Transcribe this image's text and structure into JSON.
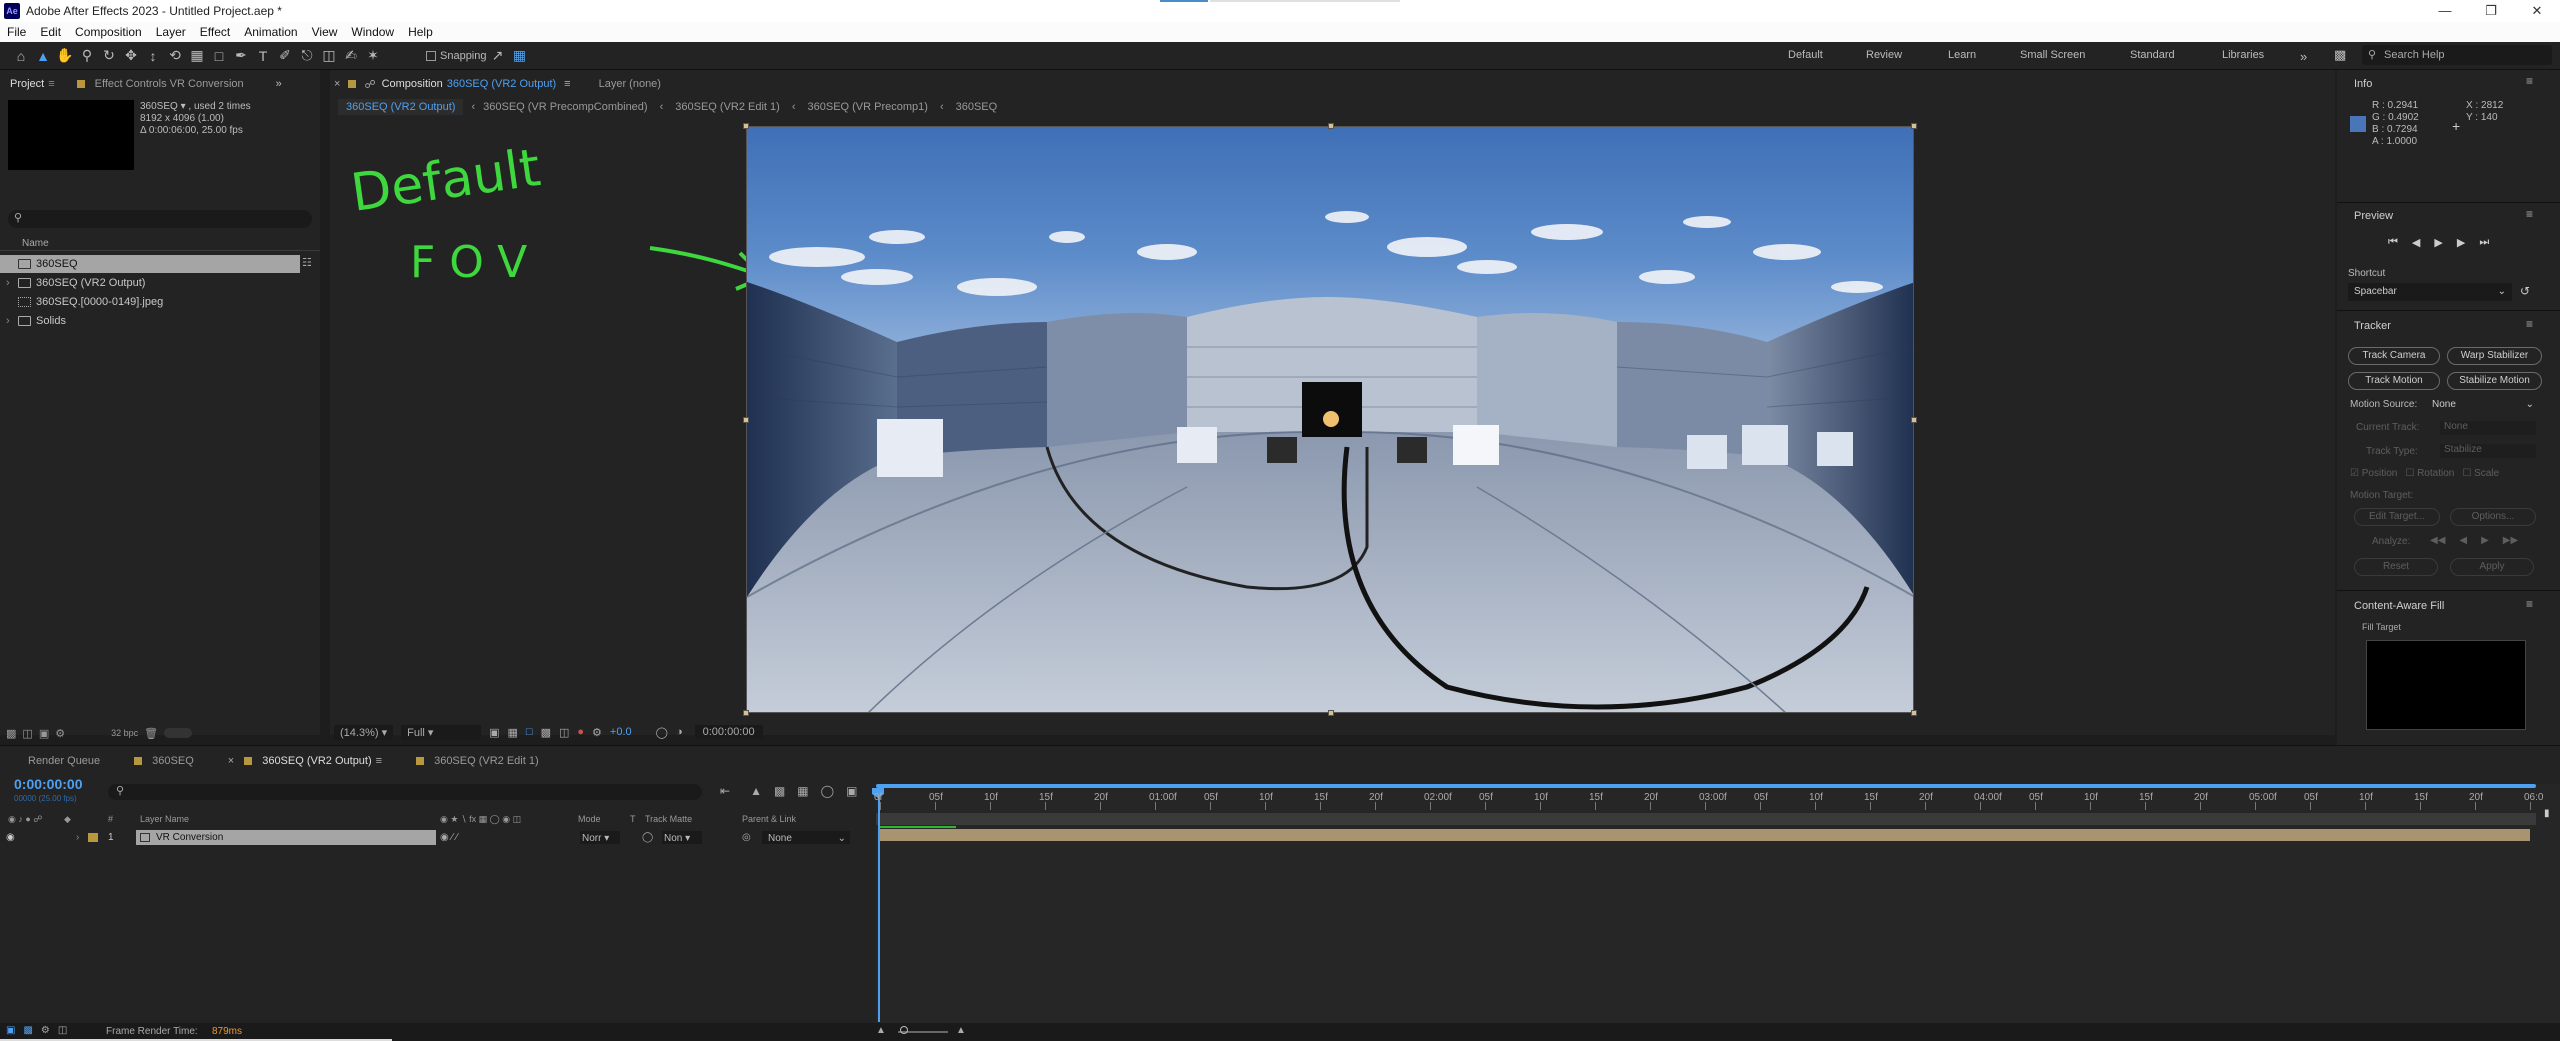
{
  "window": {
    "app_icon": "Ae",
    "title": "Adobe After Effects 2023 - Untitled Project.aep *"
  },
  "menu": [
    "File",
    "Edit",
    "Composition",
    "Layer",
    "Effect",
    "Animation",
    "View",
    "Window",
    "Help"
  ],
  "toolbar": {
    "snapping_label": "Snapping",
    "workspaces": [
      "Default",
      "Review",
      "Learn",
      "Small Screen",
      "Standard",
      "Libraries"
    ],
    "search_placeholder": "Search Help"
  },
  "project_panel": {
    "tabs": [
      "Project",
      "Effect Controls VR Conversion"
    ],
    "info_name": "360SEQ",
    "info_used": ", used 2 times",
    "info_size": "8192 x 4096 (1.00)",
    "info_duration": "Δ 0:00:06:00, 25.00 fps",
    "column_name": "Name",
    "items": [
      "360SEQ",
      "360SEQ (VR2 Output)",
      "360SEQ.[0000-0149].jpeg",
      "Solids"
    ],
    "bpc": "32 bpc"
  },
  "comp_panel": {
    "tab_prefix": "Composition",
    "tab_name": "360SEQ (VR2 Output)",
    "layer_tab": "Layer (none)",
    "breadcrumbs": [
      "360SEQ (VR2 Output)",
      "360SEQ (VR PrecompCombined)",
      "360SEQ (VR2 Edit 1)",
      "360SEQ (VR Precomp1)",
      "360SEQ"
    ],
    "zoom": "(14.3%)",
    "resolution": "Full",
    "exposure": "+0.0",
    "timecode": "0:00:00:00",
    "annotation_line1": "Default",
    "annotation_line2": "FOV"
  },
  "info_panel": {
    "title": "Info",
    "r": "R : 0.2941",
    "g": "G : 0.4902",
    "b": "B : 0.7294",
    "a": "A : 1.0000",
    "x": "X : 2812",
    "y": "Y : 140",
    "swatch_color": "#4a76b9"
  },
  "preview_panel": {
    "title": "Preview",
    "shortcut_label": "Shortcut",
    "shortcut_value": "Spacebar"
  },
  "tracker_panel": {
    "title": "Tracker",
    "track_camera": "Track Camera",
    "warp_stabilizer": "Warp Stabilizer",
    "track_motion": "Track Motion",
    "stabilize_motion": "Stabilize Motion",
    "motion_source_label": "Motion Source:",
    "motion_source_value": "None",
    "current_track_label": "Current Track:",
    "current_track_value": "None",
    "track_type_label": "Track Type:",
    "track_type_value": "Stabilize",
    "position": "Position",
    "rotation": "Rotation",
    "scale": "Scale",
    "motion_target": "Motion Target:",
    "edit_target": "Edit Target...",
    "options": "Options...",
    "analyze": "Analyze:",
    "reset": "Reset",
    "apply": "Apply"
  },
  "caf_panel": {
    "title": "Content-Aware Fill",
    "fill_target": "Fill Target"
  },
  "timeline": {
    "tabs": [
      "Render Queue",
      "360SEQ",
      "360SEQ (VR2 Output)",
      "360SEQ (VR2 Edit 1)"
    ],
    "timecode": "0:00:00:00",
    "timecode_sub": "00000 (25.00 fps)",
    "columns": {
      "layer_name": "Layer Name",
      "mode": "Mode",
      "t": "T",
      "track_matte": "Track Matte",
      "parent_link": "Parent & Link"
    },
    "layer": {
      "index": "1",
      "name": "VR Conversion",
      "mode": "Norr",
      "matte": "Non",
      "parent": "None"
    },
    "ruler": [
      "0f",
      "05f",
      "10f",
      "15f",
      "20f",
      "01:00f",
      "05f",
      "10f",
      "15f",
      "20f",
      "02:00f",
      "05f",
      "10f",
      "15f",
      "20f",
      "03:00f",
      "05f",
      "10f",
      "15f",
      "20f",
      "04:00f",
      "05f",
      "10f",
      "15f",
      "20f",
      "05:00f",
      "05f",
      "10f",
      "15f",
      "20f",
      "06:0"
    ]
  },
  "status": {
    "frame_render_label": "Frame Render Time:",
    "frame_render_value": "879ms"
  }
}
